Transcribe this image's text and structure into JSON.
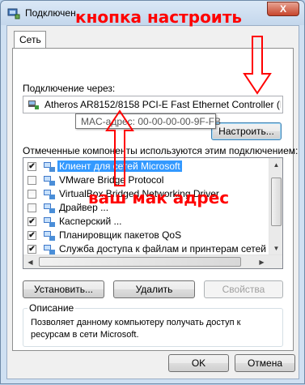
{
  "window": {
    "title": "Подключен",
    "close_label": "X"
  },
  "tabs": [
    {
      "label": "Сеть"
    }
  ],
  "connection": {
    "label": "Подключение через:",
    "adapter_name": "Atheros AR8152/8158 PCI-E Fast Ethernet Controller (ND",
    "configure_button": "Настроить...",
    "mac_tooltip": "MAC-адрес: 00-00-00-00-9F-FB"
  },
  "components": {
    "label": "Отмеченные компоненты используются этим подключением:",
    "items": [
      {
        "label": "Клиент для сетей Microsoft",
        "checked": "✔",
        "selected": true
      },
      {
        "label": "VMware Bridge Protocol",
        "checked": "",
        "selected": false
      },
      {
        "label": "VirtualBox Bridged Networking Driver",
        "checked": "",
        "selected": false
      },
      {
        "label": "Драйвер ...",
        "checked": "",
        "selected": false
      },
      {
        "label": "Касперский ...",
        "checked": "✔",
        "selected": false
      },
      {
        "label": "Планировщик пакетов QoS",
        "checked": "✔",
        "selected": false
      },
      {
        "label": "Служба доступа к файлам и принтерам сетей Micro",
        "checked": "✔",
        "selected": false
      }
    ]
  },
  "actions": {
    "install": "Установить...",
    "uninstall": "Удалить",
    "properties": "Свойства"
  },
  "description": {
    "title": "Описание",
    "text": "Позволяет данному компьютеру получать доступ к ресурсам в сети Microsoft."
  },
  "footer": {
    "ok": "OK",
    "cancel": "Отмена"
  },
  "annotations": {
    "configure_hint": "кнопка настроить",
    "mac_hint": "ваш мак адрес",
    "color": "#ff0000"
  }
}
